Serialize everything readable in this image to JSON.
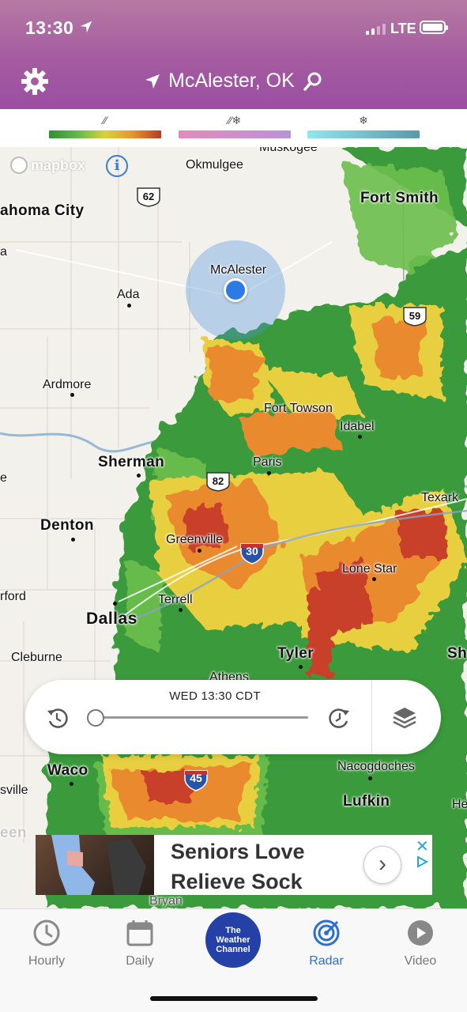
{
  "status_bar": {
    "time": "13:30",
    "network": "LTE"
  },
  "header": {
    "location": "McAlester, OK"
  },
  "legend": [
    {
      "name": "rain",
      "icon": "rain-icon",
      "symbol": "⁄⁄"
    },
    {
      "name": "mix",
      "icon": "mix-icon",
      "symbol": "⁄⁄❄"
    },
    {
      "name": "snow",
      "icon": "snow-icon",
      "symbol": "❄"
    }
  ],
  "map": {
    "attribution": "mapbox",
    "current_location": "McAlester",
    "cities": {
      "muskogee": "Muskogee",
      "okmulgee": "Okmulgee",
      "oklahoma_city": "ahoma City",
      "fort_smith": "Fort Smith",
      "ada": "Ada",
      "ardmore": "Ardmore",
      "fort_towson": "Fort Towson",
      "idabel": "Idabel",
      "sherman": "Sherman",
      "paris": "Paris",
      "texarkana": "Texark",
      "denton": "Denton",
      "greenville": "Greenville",
      "lone_star": "Lone Star",
      "terrell": "Terrell",
      "dallas": "Dallas",
      "fort_worth": "rford",
      "cleburne": "Cleburne",
      "tyler": "Tyler",
      "shreveport": "Sh",
      "athens": "Athens",
      "waco": "Waco",
      "nacogdoches": "Nacogdoches",
      "lufkin": "Lufkin",
      "huntsville": "He",
      "killeen": "sville",
      "killeen2": "een",
      "bryan": "Bryan",
      "left_edge": "a",
      "left_edge2": "e"
    },
    "highways": {
      "us62": "62",
      "us59": "59",
      "us82": "82",
      "i30": "30",
      "i45": "45"
    }
  },
  "timeline": {
    "label": "WED 13:30 CDT",
    "progress": 0
  },
  "ad": {
    "title": "Seniors Love\nRelieve Sock"
  },
  "tabs": [
    {
      "label": "Hourly",
      "icon": "clock-icon"
    },
    {
      "label": "Daily",
      "icon": "calendar-icon"
    },
    {
      "label": "The Weather Channel",
      "icon": "twc-logo"
    },
    {
      "label": "Radar",
      "icon": "radar-icon",
      "active": true
    },
    {
      "label": "Video",
      "icon": "play-icon"
    }
  ],
  "colors": {
    "header": "#a45ba0",
    "accent": "#2b6fd6",
    "location_dot": "#2c7be5",
    "twc": "#2541a7"
  }
}
